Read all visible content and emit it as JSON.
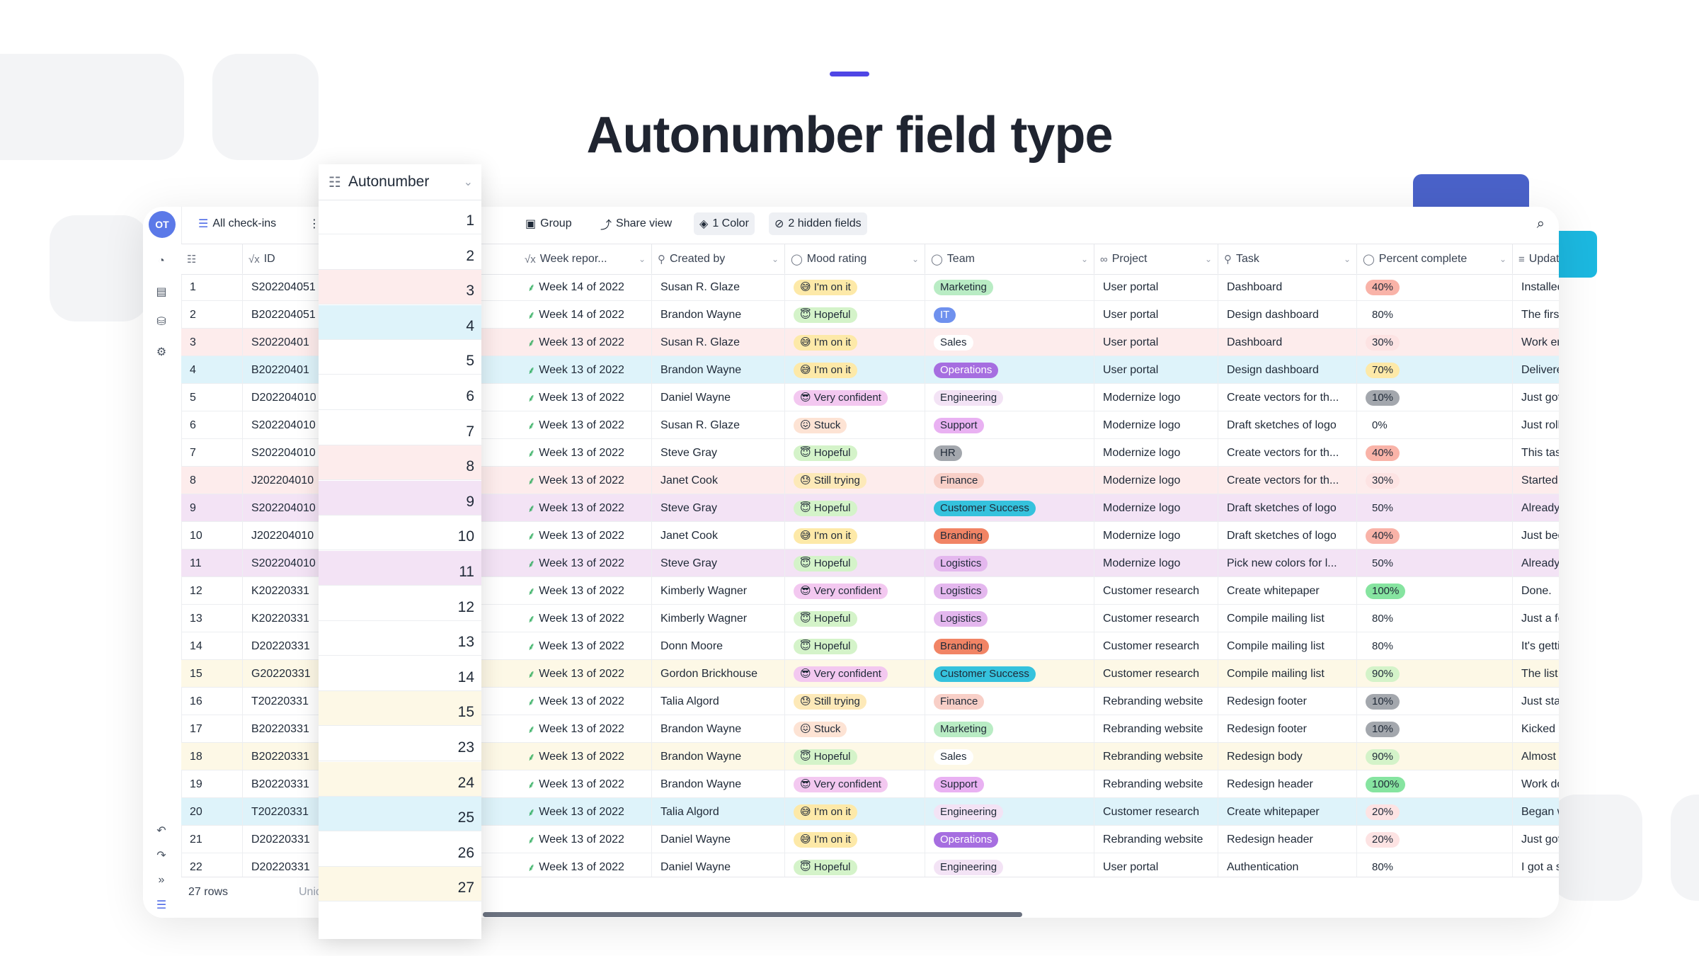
{
  "heading": "Autonumber field type",
  "toolbar": {
    "avatar": "OT",
    "view_name": "All check-ins",
    "group": "Group",
    "share": "Share view",
    "color": "1 Color",
    "hidden": "2 hidden fields"
  },
  "panel": {
    "title": "Autonumber",
    "values": [
      "1",
      "2",
      "3",
      "4",
      "5",
      "6",
      "7",
      "8",
      "9",
      "10",
      "11",
      "12",
      "13",
      "14",
      "15",
      "23",
      "24",
      "25",
      "26",
      "27"
    ]
  },
  "columns": {
    "id": "ID",
    "week": "Week repor...",
    "created_by": "Created by",
    "mood": "Mood rating",
    "team": "Team",
    "project": "Project",
    "task": "Task",
    "percent": "Percent complete",
    "updates": "Updates"
  },
  "footer": {
    "rows": "27 rows",
    "unique": "Uniq"
  },
  "colors": {
    "row_red": "#fdecec",
    "row_blue": "#def3fa",
    "row_purple": "#f3e3f5",
    "row_yellow": "#fdf8e6",
    "Marketing": "#b9ecc4",
    "IT": "#6f91ee",
    "Sales": "#ffffff",
    "Operations": "#a66ee0",
    "Engineering": "#f3e3f5",
    "Support": "#e9b1f2",
    "HR": "#a3a7ad",
    "Finance": "#f8cfc7",
    "Customer Success": "#35c2dd",
    "Branding": "#f18465",
    "Logistics": "#e4b7ee"
  },
  "rows": [
    {
      "n": "1",
      "id": "S202204051",
      "week": "Week 14 of 2022",
      "by": "Susan R. Glaze",
      "mood": "😅 I'm on it",
      "team": "Marketing",
      "project": "User portal",
      "task": "Dashboard",
      "pct": "40%",
      "upd": "Installed the r",
      "bg": "none"
    },
    {
      "n": "2",
      "id": "B202204051",
      "week": "Week 14 of 2022",
      "by": "Brandon Wayne",
      "mood": "😇 Hopeful",
      "team": "IT",
      "project": "User portal",
      "task": "Design dashboard",
      "pct": "80%",
      "upd": "The first secti",
      "bg": "none"
    },
    {
      "n": "3",
      "id": "S20220401",
      "week": "Week 13 of 2022",
      "by": "Susan R. Glaze",
      "mood": "😅 I'm on it",
      "team": "Sales",
      "project": "User portal",
      "task": "Dashboard",
      "pct": "30%",
      "upd": "Work environ",
      "bg": "red"
    },
    {
      "n": "4",
      "id": "B20220401",
      "week": "Week 13 of 2022",
      "by": "Brandon Wayne",
      "mood": "😅 I'm on it",
      "team": "Operations",
      "project": "User portal",
      "task": "Design dashboard",
      "pct": "70%",
      "upd": "Delivered a fe",
      "bg": "blue"
    },
    {
      "n": "5",
      "id": "D202204010",
      "week": "Week 13 of 2022",
      "by": "Daniel Wayne",
      "mood": "😎 Very confident",
      "team": "Engineering",
      "project": "Modernize logo",
      "task": "Create vectors for th...",
      "pct": "10%",
      "upd": "Just got the t",
      "bg": "none"
    },
    {
      "n": "6",
      "id": "S202204010",
      "week": "Week 13 of 2022",
      "by": "Susan R. Glaze",
      "mood": "😖 Stuck",
      "team": "Support",
      "project": "Modernize logo",
      "task": "Draft sketches of logo",
      "pct": "0%",
      "upd": "Just rolled in",
      "bg": "none"
    },
    {
      "n": "7",
      "id": "S202204010",
      "week": "Week 13 of 2022",
      "by": "Steve Gray",
      "mood": "😇 Hopeful",
      "team": "HR",
      "project": "Modernize logo",
      "task": "Create vectors for th...",
      "pct": "40%",
      "upd": "This task is ro",
      "bg": "none"
    },
    {
      "n": "8",
      "id": "J202204010",
      "week": "Week 13 of 2022",
      "by": "Janet Cook",
      "mood": "😓 Still trying",
      "team": "Finance",
      "project": "Modernize logo",
      "task": "Create vectors for th...",
      "pct": "30%",
      "upd": "Started creati",
      "bg": "red"
    },
    {
      "n": "9",
      "id": "S202204010",
      "week": "Week 13 of 2022",
      "by": "Steve Gray",
      "mood": "😇 Hopeful",
      "team": "Customer Success",
      "project": "Modernize logo",
      "task": "Draft sketches of logo",
      "pct": "50%",
      "upd": "Already have",
      "bg": "purple"
    },
    {
      "n": "10",
      "id": "J202204010",
      "week": "Week 13 of 2022",
      "by": "Janet Cook",
      "mood": "😅 I'm on it",
      "team": "Branding",
      "project": "Modernize logo",
      "task": "Draft sketches of logo",
      "pct": "40%",
      "upd": "Just began w",
      "bg": "none"
    },
    {
      "n": "11",
      "id": "S202204010",
      "week": "Week 13 of 2022",
      "by": "Steve Gray",
      "mood": "😇 Hopeful",
      "team": "Logistics",
      "project": "Modernize logo",
      "task": "Pick new colors for l...",
      "pct": "50%",
      "upd": "Already have",
      "bg": "purple"
    },
    {
      "n": "12",
      "id": "K20220331",
      "week": "Week 13 of 2022",
      "by": "Kimberly Wagner",
      "mood": "😎 Very confident",
      "team": "Logistics",
      "project": "Customer research",
      "task": "Create whitepaper",
      "pct": "100%",
      "upd": "Done.",
      "bg": "none"
    },
    {
      "n": "13",
      "id": "K20220331",
      "week": "Week 13 of 2022",
      "by": "Kimberly Wagner",
      "mood": "😇 Hopeful",
      "team": "Logistics",
      "project": "Customer research",
      "task": "Compile mailing list",
      "pct": "80%",
      "upd": "Just a few mo",
      "bg": "none"
    },
    {
      "n": "14",
      "id": "D20220331",
      "week": "Week 13 of 2022",
      "by": "Donn Moore",
      "mood": "😇 Hopeful",
      "team": "Branding",
      "project": "Customer research",
      "task": "Compile mailing list",
      "pct": "80%",
      "upd": "It's getting th",
      "bg": "none"
    },
    {
      "n": "15",
      "id": "G20220331",
      "week": "Week 13 of 2022",
      "by": "Gordon Brickhouse",
      "mood": "😎 Very confident",
      "team": "Customer Success",
      "project": "Customer research",
      "task": "Compile mailing list",
      "pct": "90%",
      "upd": "The list is alm",
      "bg": "yellow"
    },
    {
      "n": "16",
      "id": "T20220331",
      "week": "Week 13 of 2022",
      "by": "Talia Algord",
      "mood": "😓 Still trying",
      "team": "Finance",
      "project": "Rebranding website",
      "task": "Redesign footer",
      "pct": "10%",
      "upd": "Just started t",
      "bg": "none"
    },
    {
      "n": "17",
      "id": "B20220331",
      "week": "Week 13 of 2022",
      "by": "Brandon Wayne",
      "mood": "😖 Stuck",
      "team": "Marketing",
      "project": "Rebranding website",
      "task": "Redesign footer",
      "pct": "10%",
      "upd": "Kicked off thi",
      "bg": "none"
    },
    {
      "n": "18",
      "id": "B20220331",
      "week": "Week 13 of 2022",
      "by": "Brandon Wayne",
      "mood": "😇 Hopeful",
      "team": "Sales",
      "project": "Rebranding website",
      "task": "Redesign body",
      "pct": "90%",
      "upd": "Almost done v",
      "bg": "yellow"
    },
    {
      "n": "19",
      "id": "B20220331",
      "week": "Week 13 of 2022",
      "by": "Brandon Wayne",
      "mood": "😎 Very confident",
      "team": "Support",
      "project": "Rebranding website",
      "task": "Redesign header",
      "pct": "100%",
      "upd": "Work done. S",
      "bg": "none"
    },
    {
      "n": "20",
      "id": "T20220331",
      "week": "Week 13 of 2022",
      "by": "Talia Algord",
      "mood": "😅 I'm on it",
      "team": "Engineering",
      "project": "Customer research",
      "task": "Create whitepaper",
      "pct": "20%",
      "upd": "Began workin",
      "bg": "blue"
    },
    {
      "n": "21",
      "id": "D20220331",
      "week": "Week 13 of 2022",
      "by": "Daniel Wayne",
      "mood": "😅 I'm on it",
      "team": "Operations",
      "project": "Rebranding website",
      "task": "Redesign header",
      "pct": "20%",
      "upd": "Just got rolle",
      "bg": "none"
    },
    {
      "n": "22",
      "id": "D20220331",
      "week": "Week 13 of 2022",
      "by": "Daniel Wayne",
      "mood": "😇 Hopeful",
      "team": "Engineering",
      "project": "User portal",
      "task": "Authentication",
      "pct": "80%",
      "upd": "I got a server",
      "bg": "none"
    }
  ]
}
